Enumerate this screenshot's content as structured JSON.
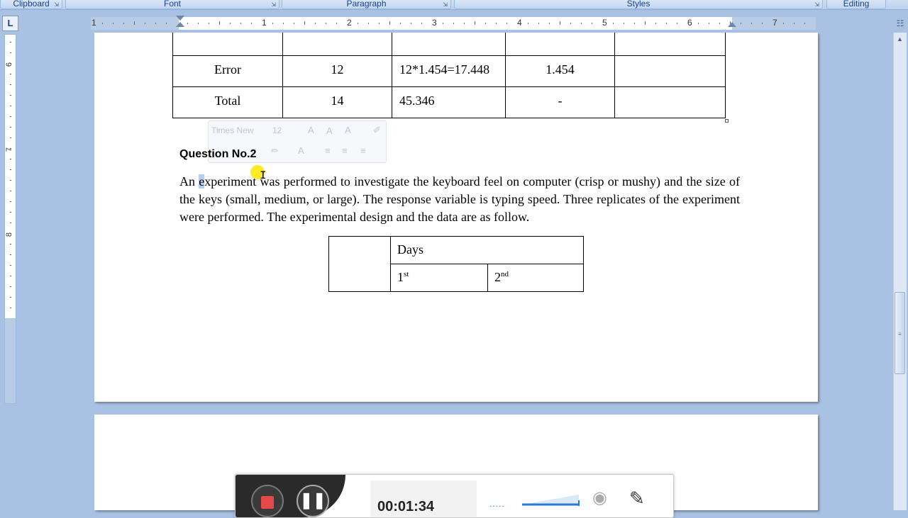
{
  "ribbon": {
    "groups": [
      {
        "label": "Clipboard"
      },
      {
        "label": "Font"
      },
      {
        "label": "Paragraph"
      },
      {
        "label": "Styles"
      },
      {
        "label": "Editing"
      }
    ]
  },
  "ruler": {
    "corner_glyph": "L",
    "numbers": [
      "1",
      "1",
      "2",
      "3",
      "4",
      "5",
      "6",
      "7"
    ],
    "vertical_numbers": [
      "6",
      "7",
      "8"
    ]
  },
  "anova_table": {
    "rows": [
      {
        "source": "",
        "df": "",
        "ss": "",
        "ms": "",
        "f": ""
      },
      {
        "source": "Error",
        "df": "12",
        "ss": "12*1.454=17.448",
        "ms": "1.454",
        "f": ""
      },
      {
        "source": "Total",
        "df": "14",
        "ss": "45.346",
        "ms": "-",
        "f": ""
      }
    ]
  },
  "mini_toolbar": {
    "font_name": "Times New",
    "font_size": "12"
  },
  "question": {
    "title": "Question No.2",
    "text_before_sel": "An ",
    "text_sel": "e",
    "text_after_sel": "xperiment was performed to investigate the keyboard feel on computer (crisp or mushy) and the size of the keys (small, medium, or large). The response variable is typing speed. Three replicates of the experiment were performed. The experimental design and the data are as follow."
  },
  "days_table": {
    "header": "Days",
    "col1_num": "1",
    "col1_sup": "st",
    "col2_num": "2",
    "col2_sup": "nd"
  },
  "recorder": {
    "time": "00:01:34",
    "stop_icon": "stop-icon",
    "pause_icon": "pause-icon",
    "webcam_icon": "webcam-icon",
    "pen_icon": "pen-icon",
    "accent": "#2a7ad0"
  },
  "colors": {
    "ribbon_text": "#15428b",
    "selection": "#b5cdef",
    "background": "#a9c1e2"
  }
}
